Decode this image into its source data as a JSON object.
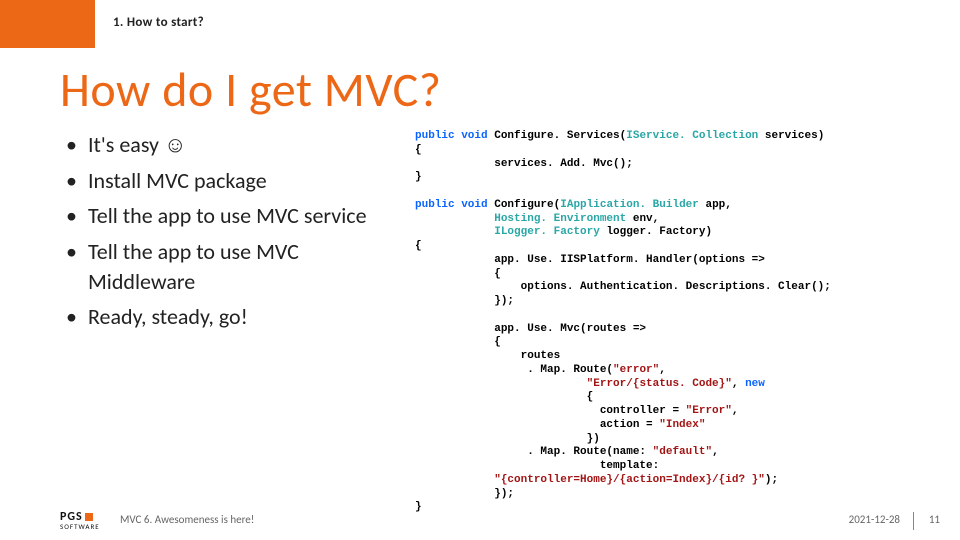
{
  "section": "1. How to start?",
  "title": "How do I get MVC?",
  "bullets": [
    "It's easy ☺",
    "Install MVC package",
    "Tell the app to use MVC service",
    "Tell the app to use MVC Middleware",
    "Ready, steady, go!"
  ],
  "code": {
    "sig1_pre": "public void",
    "sig1_name": " Configure. Services(",
    "sig1_arg_ty": "IService. Collection",
    "sig1_arg_nm": " services)",
    "l_open1": "{",
    "l_body1": "            services. Add. Mvc();",
    "l_close1": "}",
    "sig2_pre": "public void",
    "sig2_name": " Configure(",
    "sig2_arg1_ty": "IApplication. Builder",
    "sig2_arg1_nm": " app,",
    "sig2_arg2_pre": "            ",
    "sig2_arg2_ty": "Hosting. Environment",
    "sig2_arg2_nm": " env,",
    "sig2_arg3_pre": "            ",
    "sig2_arg3_ty": "ILogger. Factory",
    "sig2_arg3_nm": " logger. Factory)",
    "l_open2": "{",
    "b2_l1": "            app. Use. IISPlatform. Handler(options =>",
    "b2_l2": "            {",
    "b2_l3": "                options. Authentication. Descriptions. Clear();",
    "b2_l4": "            });",
    "b2_blank1": "",
    "b2_l5": "            app. Use. Mvc(routes =>",
    "b2_l6": "            {",
    "b2_l7": "                routes",
    "b2_l8a": "                 . Map. Route(",
    "b2_l8s1": "\"error\"",
    "b2_l8b": ",",
    "b2_l9a": "                          ",
    "b2_l9s": "\"Error/{status. Code}\"",
    "b2_l9b": ", ",
    "b2_l9kw": "new",
    "b2_l10": "                          {",
    "b2_l11a": "                            controller = ",
    "b2_l11s": "\"Error\"",
    "b2_l11b": ",",
    "b2_l12a": "                            action = ",
    "b2_l12s": "\"Index\"",
    "b2_l13": "                          })",
    "b2_l14a": "                 . Map. Route(name: ",
    "b2_l14s": "\"default\"",
    "b2_l14b": ",",
    "b2_l15": "                            template:",
    "b2_l16a": "            ",
    "b2_l16s": "\"{controller=Home}/{action=Index}/{id? }\"",
    "b2_l16b": ");",
    "b2_l17": "            });",
    "l_close2": "}"
  },
  "footer": {
    "logo_name": "PGS",
    "logo_sub": "SOFTWARE",
    "tagline": "MVC 6. Awesomeness is here!",
    "date": "2021-12-28",
    "page": "11"
  }
}
